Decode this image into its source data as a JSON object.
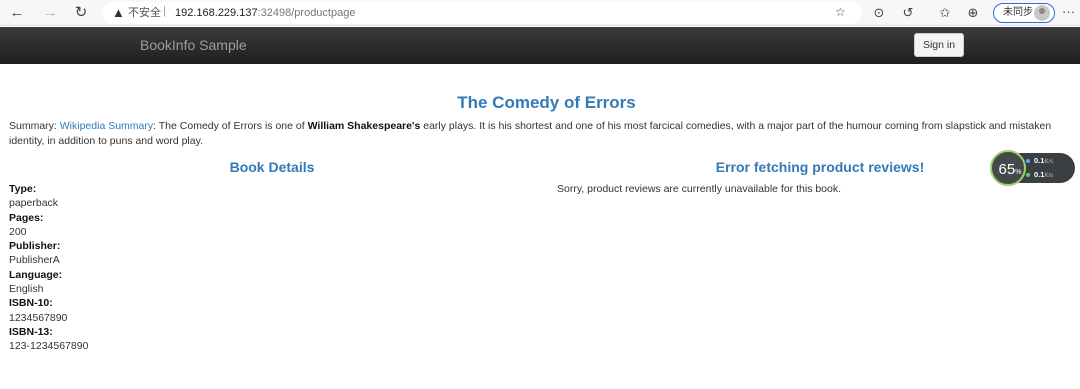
{
  "browser": {
    "back_icon": "arrow-left-icon",
    "forward_icon": "arrow-right-icon",
    "reload_icon": "reload-icon",
    "warning_icon": "warning-icon",
    "insecure_label": "不安全",
    "url_host": "192.168.229.137",
    "url_rest": ":32498/productpage",
    "profile_label": "未同步",
    "more_label": "···"
  },
  "navbar": {
    "brand": "BookInfo Sample",
    "signin_label": "Sign in"
  },
  "product": {
    "title": "The Comedy of Errors",
    "summary_prefix": "Summary: ",
    "summary_link": "Wikipedia Summary",
    "summary_text_1": ": The Comedy of Errors is one of ",
    "summary_bold": "William Shakespeare's",
    "summary_text_2": " early plays. It is his shortest and one of his most farcical comedies, with a major part of the humour coming from slapstick and mistaken identity, in addition to puns and word play."
  },
  "details": {
    "heading": "Book Details",
    "items": [
      {
        "label": "Type:",
        "value": "paperback"
      },
      {
        "label": "Pages:",
        "value": "200"
      },
      {
        "label": "Publisher:",
        "value": "PublisherA"
      },
      {
        "label": "Language:",
        "value": "English"
      },
      {
        "label": "ISBN-10:",
        "value": "1234567890"
      },
      {
        "label": "ISBN-13:",
        "value": "123-1234567890"
      }
    ]
  },
  "reviews": {
    "heading": "Error fetching product reviews!",
    "message": "Sorry, product reviews are currently unavailable for this book."
  },
  "widget": {
    "percent": "65",
    "percent_unit": "%",
    "upload": "0.1",
    "download": "0.1",
    "unit": "K/s",
    "upload_color": "#5aa9ff",
    "download_color": "#5fd35f"
  }
}
